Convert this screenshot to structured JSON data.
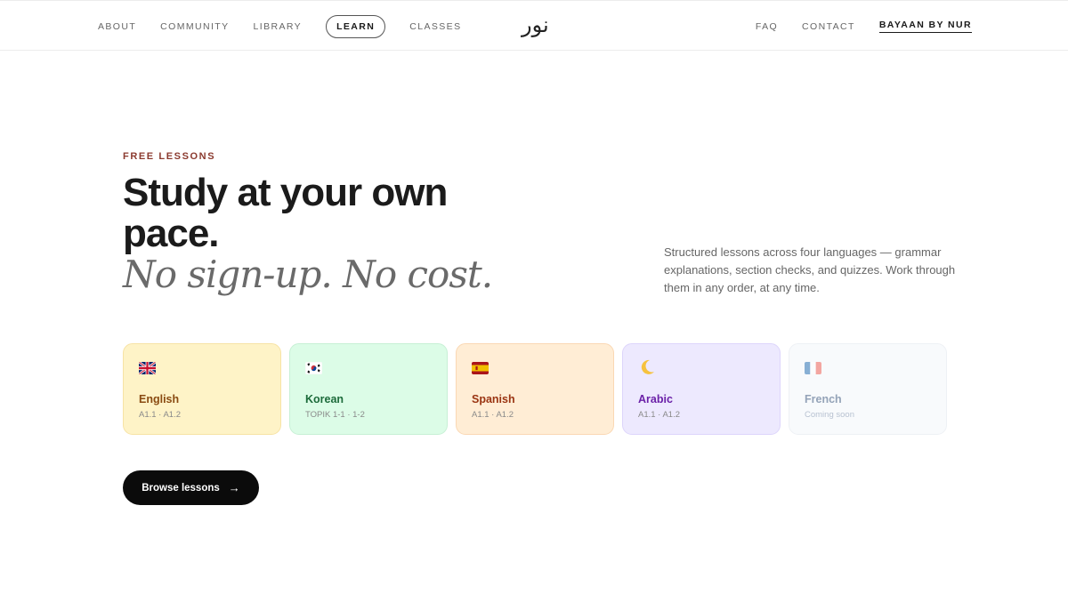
{
  "nav": {
    "left": [
      "ABOUT",
      "COMMUNITY",
      "LIBRARY",
      "LEARN",
      "CLASSES"
    ],
    "active": "LEARN",
    "logo": "نور",
    "right": [
      "FAQ",
      "CONTACT",
      "BAYAAN BY NUR"
    ]
  },
  "hero": {
    "eyebrow": "FREE LESSONS",
    "headline": "Study at your own pace.",
    "headline_italic": "No sign-up. No cost.",
    "intro": "Structured lessons across four languages — grammar explanations, section checks, and quizzes. Work through them in any order, at any time."
  },
  "languages": [
    {
      "name": "English",
      "level": "A1.1 · A1.2",
      "icon": "uk-flag-icon"
    },
    {
      "name": "Korean",
      "level": "TOPIK 1-1 · 1-2",
      "icon": "korea-flag-icon"
    },
    {
      "name": "Spanish",
      "level": "A1.1 · A1.2",
      "icon": "spain-flag-icon"
    },
    {
      "name": "Arabic",
      "level": "A1.1 · A1.2",
      "icon": "crescent-moon-icon"
    },
    {
      "name": "French",
      "level": "Coming soon",
      "icon": "france-flag-icon"
    }
  ],
  "cta": {
    "label": "Browse lessons",
    "icon": "arrow-right-icon"
  },
  "colors": {
    "accent": "#8b3a2f",
    "cta_bg": "#0b0b0b",
    "english": "#fef3c7",
    "korean": "#dcfce7",
    "spanish": "#ffedd5",
    "arabic": "#ede9fe",
    "french": "#f8fafc"
  }
}
